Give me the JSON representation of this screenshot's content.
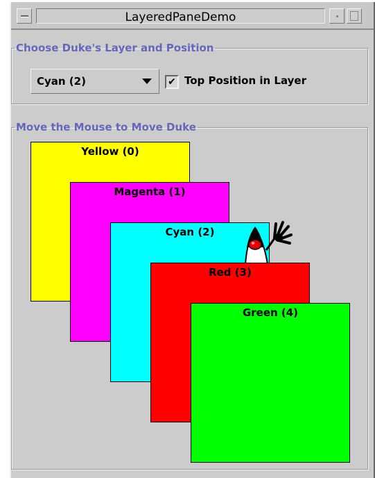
{
  "window": {
    "title": "LayeredPaneDemo"
  },
  "layer_group": {
    "legend": "Choose Duke's Layer and Position",
    "combo_value": "Cyan (2)",
    "checkbox_checked": true,
    "checkbox_mark": "✔",
    "checkbox_label": "Top Position in Layer"
  },
  "move_group": {
    "legend": "Move the Mouse to Move Duke"
  },
  "layers": [
    {
      "label": "Yellow (0)",
      "color": "#ffff00"
    },
    {
      "label": "Magenta (1)",
      "color": "#ff00ff"
    },
    {
      "label": "Cyan (2)",
      "color": "#00ffff"
    },
    {
      "label": "Red (3)",
      "color": "#ff0000"
    },
    {
      "label": "Green (4)",
      "color": "#00ff00"
    }
  ],
  "icons": {
    "window_menu": "window-menu-icon",
    "minimize": "minimize-icon",
    "maximize": "maximize-icon",
    "dropdown": "chevron-down-icon",
    "duke": "duke-mascot-icon"
  },
  "colors": {
    "legend_text": "#6666bb",
    "panel_bg": "#cccccc"
  }
}
